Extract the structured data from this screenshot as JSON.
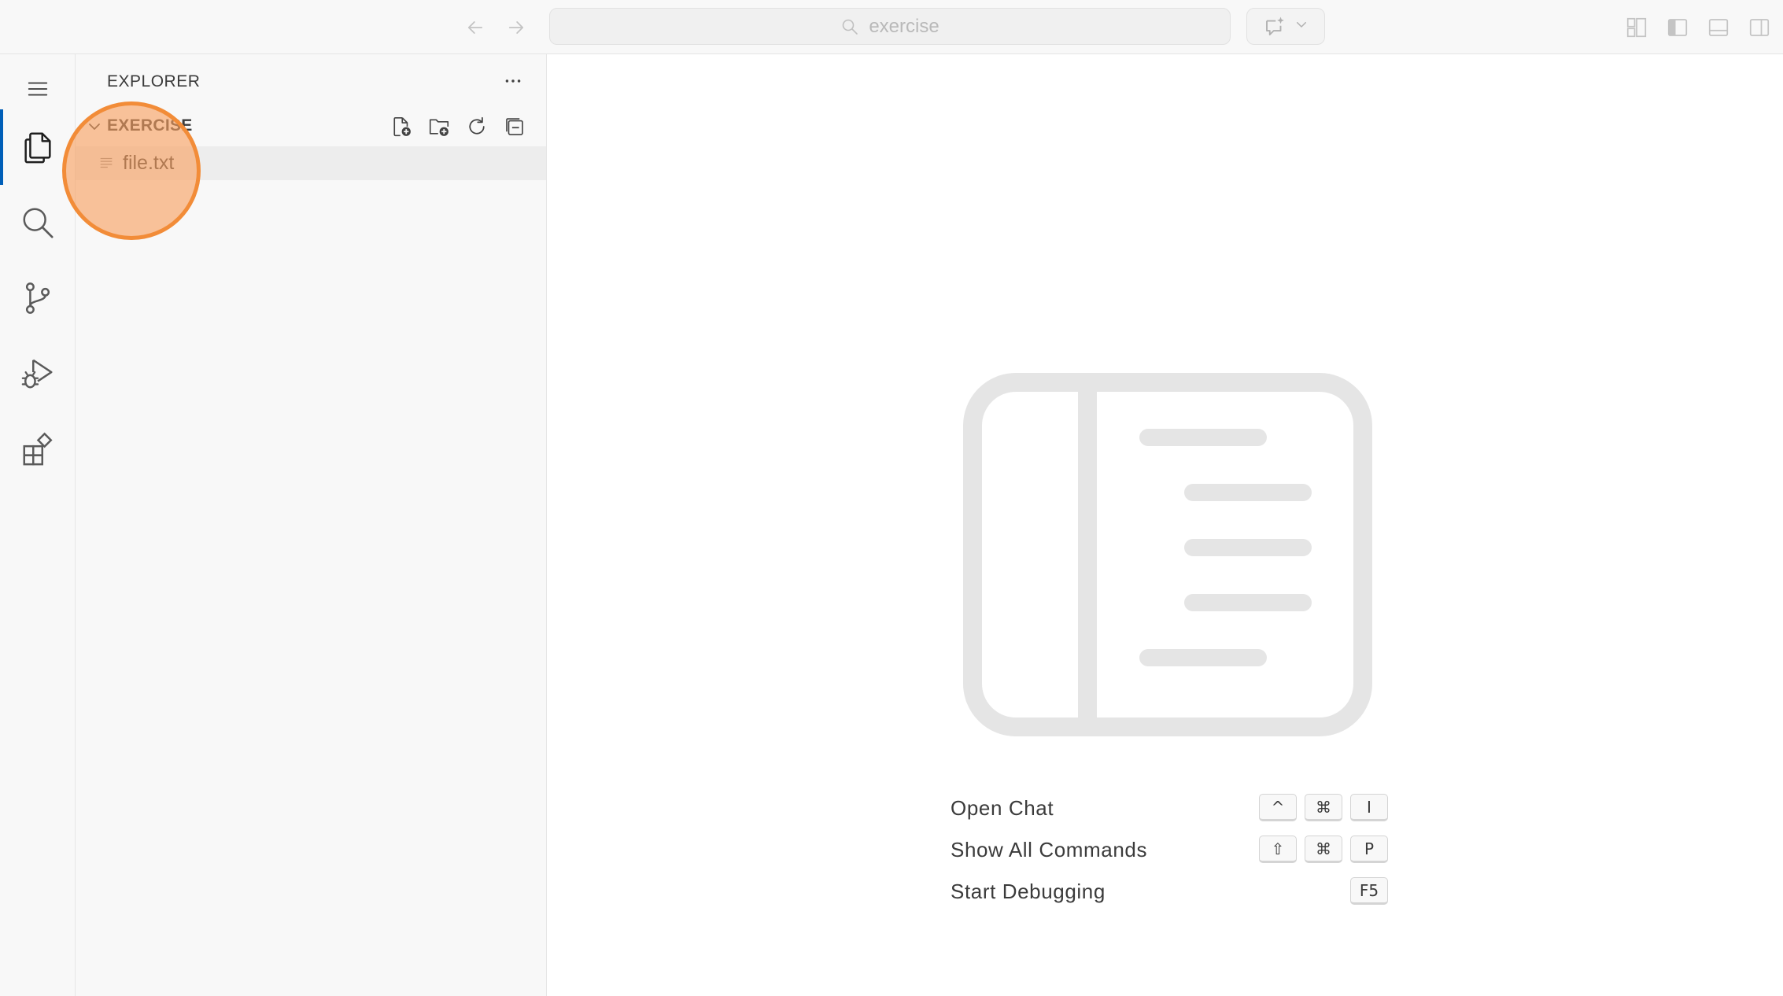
{
  "titlebar": {
    "search_text": "exercise",
    "icons": {
      "back": "arrow-left-icon",
      "forward": "arrow-right-icon",
      "search": "search-icon",
      "chat": "chat-sparkle-icon",
      "chat_menu": "chevron-down-icon",
      "customize_layout": "customize-layout-icon",
      "toggle_sidebar": "toggle-primary-sidebar-icon",
      "toggle_panel": "toggle-panel-icon",
      "toggle_secondary": "toggle-secondary-sidebar-icon"
    }
  },
  "activitybar": {
    "items": [
      {
        "name": "explorer",
        "icon": "files-icon",
        "active": true
      },
      {
        "name": "search",
        "icon": "search-icon",
        "active": false
      },
      {
        "name": "source-control",
        "icon": "source-control-icon",
        "active": false
      },
      {
        "name": "run-and-debug",
        "icon": "run-debug-icon",
        "active": false
      },
      {
        "name": "extensions",
        "icon": "extensions-icon",
        "active": false
      }
    ]
  },
  "sidebar": {
    "title": "EXPLORER",
    "folder": {
      "name": "EXERCISE",
      "actions": [
        "new-file-icon",
        "new-folder-icon",
        "refresh-icon",
        "collapse-all-icon"
      ]
    },
    "files": [
      {
        "name": "file.txt",
        "icon": "text-file-icon"
      }
    ]
  },
  "editor": {
    "shortcuts": [
      {
        "label": "Open Chat",
        "keys": [
          "^",
          "⌘",
          "I"
        ]
      },
      {
        "label": "Show All Commands",
        "keys": [
          "⇧",
          "⌘",
          "P"
        ]
      },
      {
        "label": "Start Debugging",
        "keys": [
          "F5"
        ]
      }
    ]
  },
  "colors": {
    "accent": "#005fb8",
    "click_marker": "#f28c38",
    "watermark": "#e5e5e5"
  }
}
